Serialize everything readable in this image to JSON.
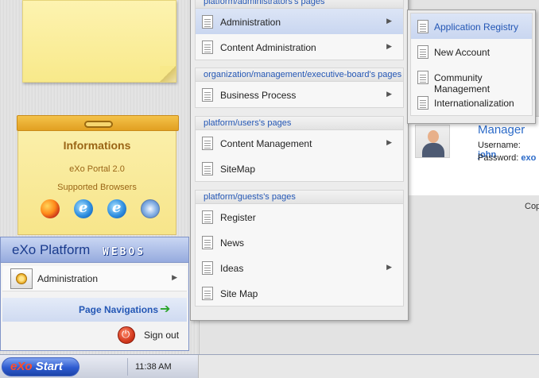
{
  "info_widget": {
    "title": "Informations",
    "line1": "eXo Portal 2.0",
    "line2": "Supported Browsers",
    "browsers": [
      "firefox-icon",
      "ie6-icon",
      "ie7-icon",
      "safari-icon"
    ]
  },
  "start_menu": {
    "brand": "eXo Platform",
    "brand_suffix": "WEBOS",
    "admin_label": "Administration",
    "page_nav_label": "Page Navigations",
    "signout_label": "Sign out"
  },
  "taskbar": {
    "start_ex": "eXo",
    "start_label": "Start",
    "clock": "11:38 AM"
  },
  "account": {
    "role": "Manager",
    "username_label": "Username:",
    "username": "john",
    "password_label": "Password:",
    "password": "exo"
  },
  "copyright": "Cop",
  "nav_menu": {
    "groups": [
      {
        "title": "platform/administrators's pages",
        "items": [
          {
            "label": "Administration",
            "has_submenu": true,
            "selected": true
          },
          {
            "label": "Content Administration",
            "has_submenu": true
          }
        ]
      },
      {
        "title": "organization/management/executive-board's pages",
        "items": [
          {
            "label": "Business Process",
            "has_submenu": true
          }
        ]
      },
      {
        "title": "platform/users's pages",
        "items": [
          {
            "label": "Content Management",
            "has_submenu": true
          },
          {
            "label": "SiteMap",
            "has_submenu": false
          }
        ]
      },
      {
        "title": "platform/guests's pages",
        "items": [
          {
            "label": "Register",
            "has_submenu": false
          },
          {
            "label": "News",
            "has_submenu": false
          },
          {
            "label": "Ideas",
            "has_submenu": true
          },
          {
            "label": "Site Map",
            "has_submenu": false
          }
        ]
      }
    ]
  },
  "admin_submenu": {
    "items": [
      {
        "label": "Application Registry",
        "selected": true
      },
      {
        "label": "New Account"
      },
      {
        "label": "Community Management"
      },
      {
        "label": "Internationalization"
      }
    ]
  },
  "colors": {
    "link_blue": "#2457b5",
    "selection": "#c9d6f0",
    "widget_yellow": "#f7e58a",
    "widget_title": "#9a6516"
  }
}
